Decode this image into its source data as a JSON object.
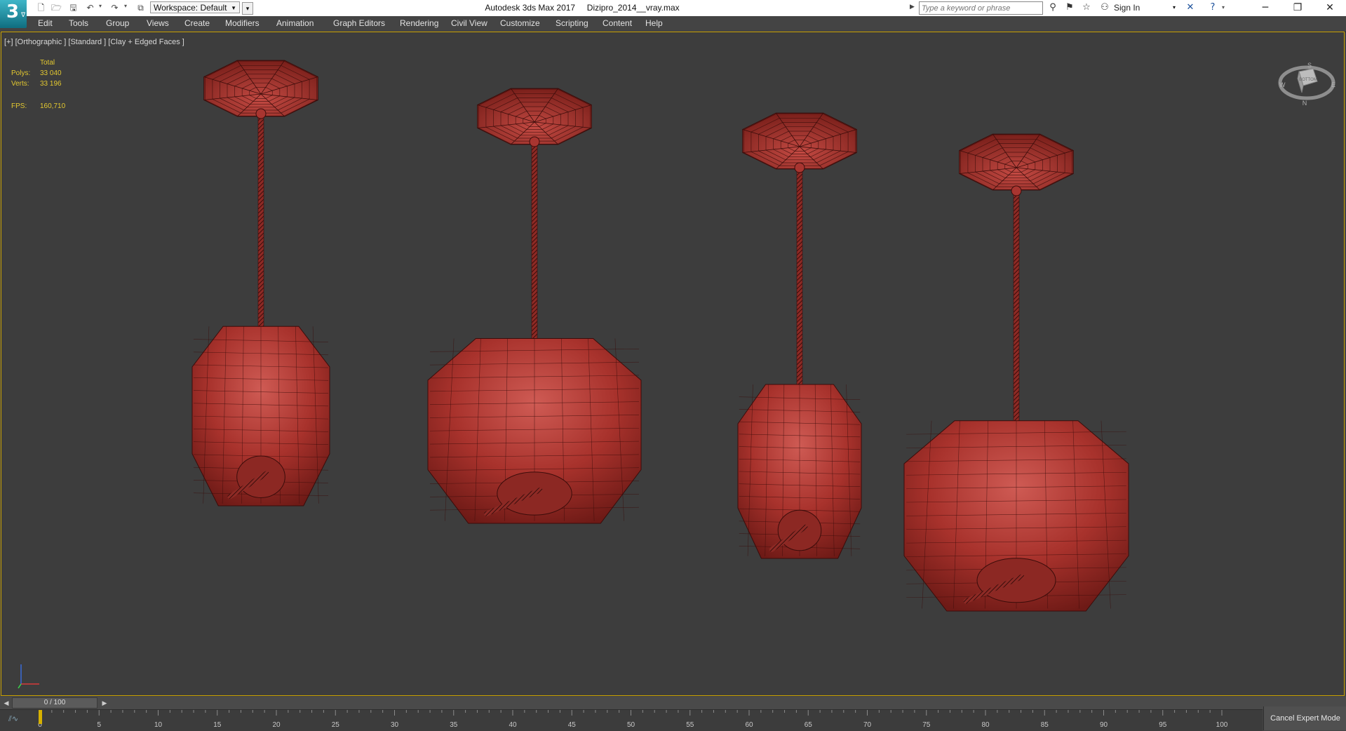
{
  "titlebar": {
    "app_logo_text": "3",
    "app_logo_sub": "ᐁ",
    "workspace_label": "Workspace: Default",
    "window_title": "Autodesk 3ds Max 2017     Dizipro_2014__vray.max",
    "search_placeholder": "Type a keyword or phrase",
    "sign_in": "Sign In"
  },
  "menu": [
    "Edit",
    "Tools",
    "Group",
    "Views",
    "Create",
    "Modifiers",
    "Animation",
    "Graph Editors",
    "Rendering",
    "Civil View",
    "Customize",
    "Scripting",
    "Content",
    "Help"
  ],
  "viewport": {
    "label": "[+] [Orthographic ] [Standard ] [Clay + Edged Faces ]",
    "stats": {
      "total_label": "Total",
      "polys_label": "Polys:",
      "polys_value": "33 040",
      "verts_label": "Verts:",
      "verts_value": "33 196",
      "fps_label": "FPS:",
      "fps_value": "160,710"
    },
    "viewcube_letters": {
      "north": "S",
      "west": "W",
      "east": "E",
      "south": "N",
      "face": "BOTTOM"
    }
  },
  "timeline": {
    "slider_label": "0 / 100",
    "frame_current": 0,
    "frame_end": 100,
    "tick_labels": [
      "0",
      "5",
      "10",
      "15",
      "20",
      "25",
      "30",
      "35",
      "40",
      "45",
      "50",
      "55",
      "60",
      "65",
      "70",
      "75",
      "80",
      "85",
      "90",
      "95",
      "100"
    ],
    "cancel_expert_mode": "Cancel Expert Mode"
  },
  "colors": {
    "viewport_bg": "#3d3d3d",
    "lamp_red": "#a8322c",
    "viewport_border": "#c8a000",
    "stats_text": "#e3c830"
  },
  "icons": {
    "new": "new-file-icon",
    "open": "open-file-icon",
    "save": "save-icon",
    "undo": "undo-icon",
    "redo": "redo-icon",
    "project": "project-folder-icon",
    "binoculars": "binoculars-icon",
    "communication": "communication-center-icon",
    "favorites": "star-icon",
    "user": "user-icon",
    "exchange": "autodesk-exchange-icon",
    "help": "help-icon"
  }
}
